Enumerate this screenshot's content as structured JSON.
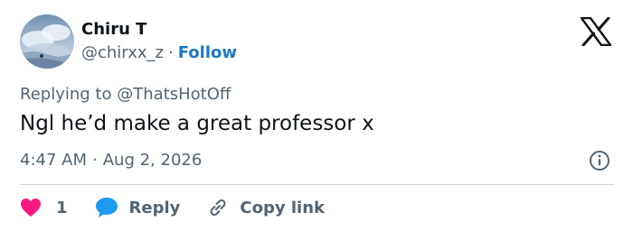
{
  "author": {
    "name": "Chiru T",
    "handle": "@chirxx_z",
    "separator": "·",
    "follow_label": "Follow"
  },
  "reply_to": {
    "prefix": "Replying to",
    "mention": "@ThatsHotOff"
  },
  "tweet": {
    "text": "Ngl he’d make a great professor x",
    "time": "4:47 AM",
    "separator": "·",
    "date": "Aug 2, 2026"
  },
  "actions": {
    "like_count": "1",
    "reply_label": "Reply",
    "copy_link_label": "Copy link"
  },
  "icons": {
    "platform_logo": "x-logo-icon",
    "like": "heart-icon",
    "reply": "speech-bubble-icon",
    "copy_link": "link-icon",
    "info": "info-icon"
  },
  "colors": {
    "like": "#f91880",
    "reply": "#1d9bf0",
    "follow": "#1d78c1",
    "secondary_text": "#536471",
    "primary_text": "#0f1419"
  }
}
